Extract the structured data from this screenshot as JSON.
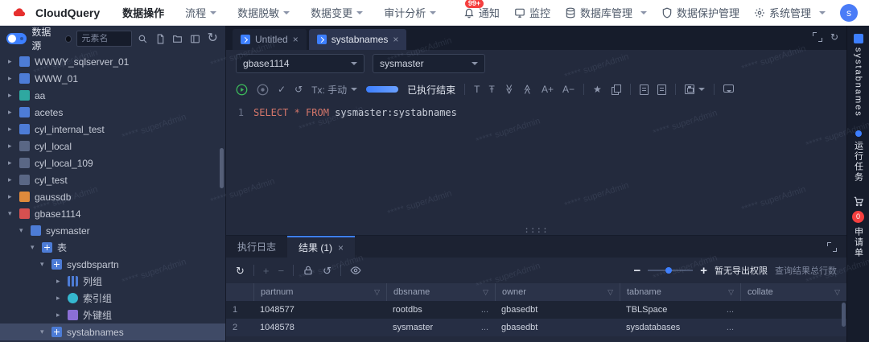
{
  "navbar": {
    "brand": "CloudQuery",
    "menu": [
      {
        "label": "数据操作"
      },
      {
        "label": "流程"
      },
      {
        "label": "数据脱敏"
      },
      {
        "label": "数据变更"
      },
      {
        "label": "审计分析"
      }
    ],
    "right": {
      "notify_badge": "99+",
      "notify_label": "通知",
      "monitor_label": "监控",
      "db_label": "数据库管理",
      "protect_label": "数据保护管理",
      "system_label": "系统管理",
      "avatar_text": "s"
    }
  },
  "sidebar": {
    "panel_label": "数据源",
    "search_placeholder": "元素名",
    "tree": [
      {
        "label": "WWWY_sqlserver_01"
      },
      {
        "label": "WWW_01"
      },
      {
        "label": "aa"
      },
      {
        "label": "acetes"
      },
      {
        "label": "cyl_internal_test"
      },
      {
        "label": "cyl_local"
      },
      {
        "label": "cyl_local_109"
      },
      {
        "label": "cyl_test"
      },
      {
        "label": "gaussdb"
      },
      {
        "label": "gbase1114"
      },
      {
        "label": "sysmaster"
      },
      {
        "label": "表"
      },
      {
        "label": "sysdbspartn"
      },
      {
        "label": "列组"
      },
      {
        "label": "索引组"
      },
      {
        "label": "外键组"
      },
      {
        "label": "systabnames"
      }
    ]
  },
  "editor": {
    "tabs": [
      {
        "label": "Untitled"
      },
      {
        "label": "systabnames"
      }
    ],
    "db_select": "gbase1114",
    "schema_select": "sysmaster",
    "toolbar": {
      "tx_label": "Tx: 手动",
      "status": "已执行结束"
    },
    "line_number": "1",
    "sql_keyword": "SELECT * FROM",
    "sql_rest": " sysmaster:systabnames",
    "watermark": "***** superAdmin"
  },
  "results": {
    "tabs": [
      {
        "label": "执行日志"
      },
      {
        "label": "结果 (1)"
      }
    ],
    "no_export_label": "暂无导出权限",
    "row_count_label": "查询结果总行数",
    "table": {
      "columns": [
        "partnum",
        "dbsname",
        "owner",
        "tabname",
        "collate"
      ],
      "rows": [
        {
          "index": "1",
          "partnum": "1048577",
          "dbsname": "rootdbs",
          "more1": "...",
          "owner": "gbasedbt",
          "tabname": "TBLSpace",
          "more2": "..."
        },
        {
          "index": "2",
          "partnum": "1048578",
          "dbsname": "sysmaster",
          "more1": "...",
          "owner": "gbasedbt",
          "tabname": "sysdatabases",
          "more2": "..."
        }
      ]
    }
  },
  "rightbar": {
    "items": [
      {
        "label": "systabnames"
      },
      {
        "label": "运行任务"
      },
      {
        "label": "申请单"
      }
    ],
    "badge": "0"
  },
  "colors": {
    "accent": "#3D7FFF",
    "brand_red": "#E6302F",
    "badge_red": "#F53F3F",
    "play_green": "#3DBD5B"
  }
}
